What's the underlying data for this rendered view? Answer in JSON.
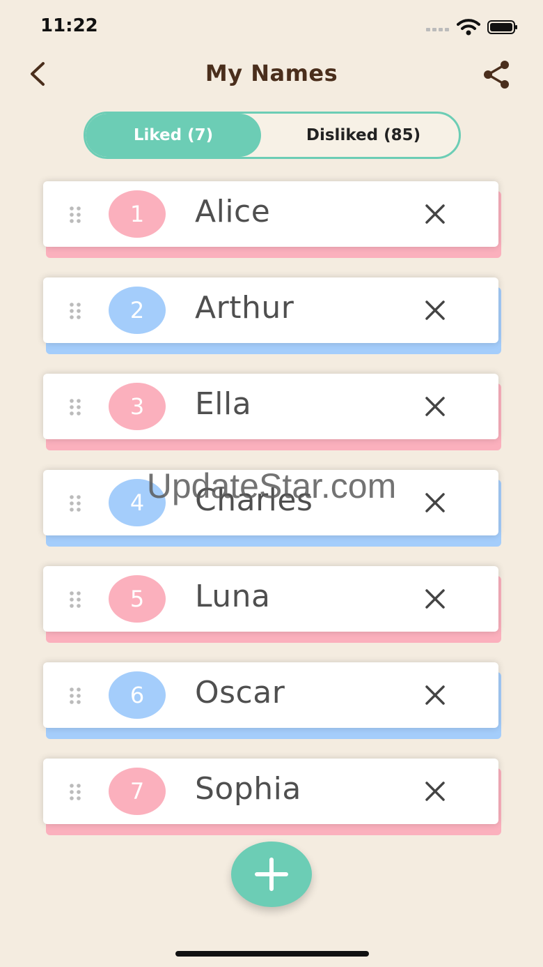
{
  "status_bar": {
    "time": "11:22"
  },
  "header": {
    "title": "My Names",
    "back_icon": "chevron-left-icon",
    "share_icon": "share-icon"
  },
  "tabs": [
    {
      "label": "Liked (7)",
      "active": true
    },
    {
      "label": "Disliked (85)",
      "active": false
    }
  ],
  "colors": {
    "accent": "#6ccdb5",
    "girl": "#fbb0bd",
    "boy": "#a4cdfb",
    "background": "#f4ece0"
  },
  "names": [
    {
      "rank": "1",
      "name": "Alice",
      "gender": "girl"
    },
    {
      "rank": "2",
      "name": "Arthur",
      "gender": "boy"
    },
    {
      "rank": "3",
      "name": "Ella",
      "gender": "girl"
    },
    {
      "rank": "4",
      "name": "Charles",
      "gender": "boy"
    },
    {
      "rank": "5",
      "name": "Luna",
      "gender": "girl"
    },
    {
      "rank": "6",
      "name": "Oscar",
      "gender": "boy"
    },
    {
      "rank": "7",
      "name": "Sophia",
      "gender": "girl"
    }
  ],
  "watermark": "UpdateStar.com"
}
